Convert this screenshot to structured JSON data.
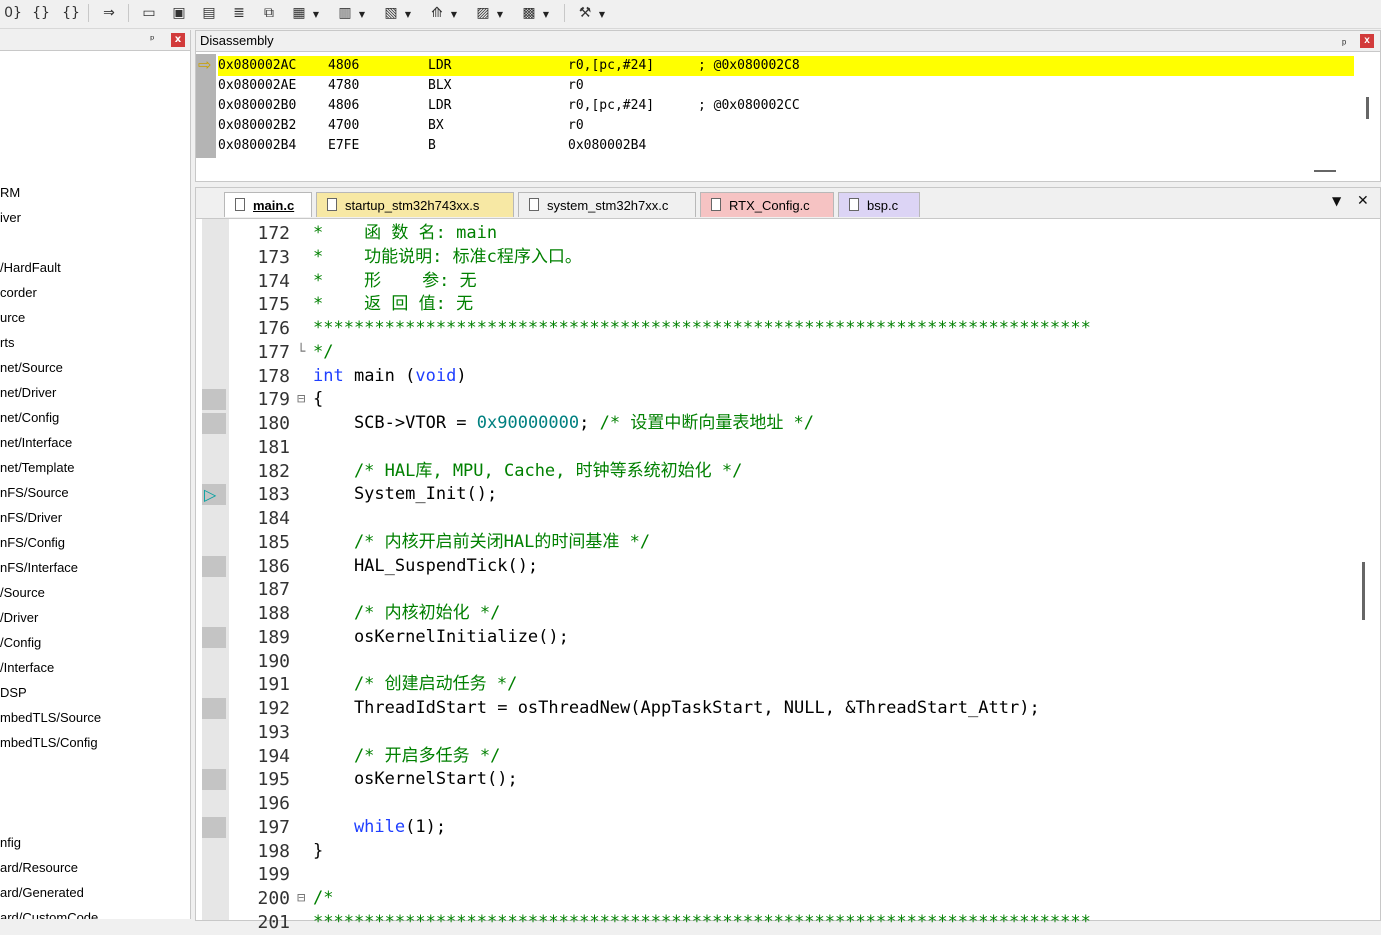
{
  "toolbar": {
    "icons": [
      {
        "name": "indent-brace-icon",
        "glyph": "0}"
      },
      {
        "name": "brace-icon",
        "glyph": "{}"
      },
      {
        "name": "unbrace-icon",
        "glyph": "{}"
      },
      {
        "name": "run-to-icon",
        "glyph": "⇒"
      },
      {
        "name": "command-window-icon",
        "glyph": "▭"
      },
      {
        "name": "disassembly-window-icon",
        "glyph": "▣"
      },
      {
        "name": "symbols-window-icon",
        "glyph": "▤"
      },
      {
        "name": "registers-window-icon",
        "glyph": "≣"
      },
      {
        "name": "call-stack-window-icon",
        "glyph": "⧉"
      },
      {
        "name": "watch-window-icon",
        "glyph": "▦"
      },
      {
        "name": "memory-window-icon",
        "glyph": "▥"
      },
      {
        "name": "serial-window-icon",
        "glyph": "▧"
      },
      {
        "name": "trace-window-icon",
        "glyph": "⟰"
      },
      {
        "name": "system-viewer-icon",
        "glyph": "▨"
      },
      {
        "name": "toolbox-icon",
        "glyph": "▩"
      },
      {
        "name": "settings-tools-icon",
        "glyph": "⚒"
      }
    ]
  },
  "left_panel": {
    "pin": "ᵖ",
    "close": "x",
    "items": [
      "RM",
      "iver",
      "/HardFault",
      "corder",
      "urce",
      "rts",
      "net/Source",
      "net/Driver",
      "net/Config",
      "net/Interface",
      "net/Template",
      "nFS/Source",
      "nFS/Driver",
      "nFS/Config",
      "nFS/Interface",
      "/Source",
      "/Driver",
      "/Config",
      "/Interface",
      "DSP",
      "mbedTLS/Source",
      "mbedTLS/Config",
      "nfig",
      "ard/Resource",
      "ard/Generated",
      "ard/CustomCode"
    ]
  },
  "disassembly": {
    "title": "Disassembly",
    "pin": "ᵖ",
    "close": "x",
    "rows": [
      {
        "addr": "0x080002AC",
        "code": "4806",
        "mnem": "LDR",
        "ops": "r0,[pc,#24]",
        "comment": "; @0x080002C8",
        "current": true
      },
      {
        "addr": "0x080002AE",
        "code": "4780",
        "mnem": "BLX",
        "ops": "r0",
        "comment": "",
        "current": false
      },
      {
        "addr": "0x080002B0",
        "code": "4806",
        "mnem": "LDR",
        "ops": "r0,[pc,#24]",
        "comment": "; @0x080002CC",
        "current": false
      },
      {
        "addr": "0x080002B2",
        "code": "4700",
        "mnem": "BX",
        "ops": "r0",
        "comment": "",
        "current": false
      },
      {
        "addr": "0x080002B4",
        "code": "E7FE",
        "mnem": "B",
        "ops": "0x080002B4",
        "comment": "",
        "current": false
      }
    ],
    "current_arrow": "⇨"
  },
  "editor": {
    "tabs": [
      {
        "label": "main.c",
        "color": "#f0f0f0",
        "active": true
      },
      {
        "label": "startup_stm32h743xx.s",
        "color": "#f7e8a4",
        "active": false
      },
      {
        "label": "system_stm32h7xx.c",
        "color": "#f0f0f0",
        "active": false
      },
      {
        "label": "RTX_Config.c",
        "color": "#f6c3c3",
        "active": false
      },
      {
        "label": "bsp.c",
        "color": "#dcd4f5",
        "active": false
      }
    ],
    "dropdown": "▼",
    "close": "✕",
    "exec_marker": "▷",
    "lines": [
      {
        "n": "172",
        "fold": "",
        "bp": false,
        "t": [
          {
            "c": "cm",
            "s": "*    函 数 名: main"
          }
        ]
      },
      {
        "n": "173",
        "fold": "",
        "bp": false,
        "t": [
          {
            "c": "cm",
            "s": "*    功能说明: 标准c程序入口。"
          }
        ]
      },
      {
        "n": "174",
        "fold": "",
        "bp": false,
        "t": [
          {
            "c": "cm",
            "s": "*    形    参: 无"
          }
        ]
      },
      {
        "n": "175",
        "fold": "",
        "bp": false,
        "t": [
          {
            "c": "cm",
            "s": "*    返 回 值: 无"
          }
        ]
      },
      {
        "n": "176",
        "fold": "",
        "bp": false,
        "t": [
          {
            "c": "cm",
            "s": "****************************************************************************"
          }
        ]
      },
      {
        "n": "177",
        "fold": "└",
        "bp": false,
        "t": [
          {
            "c": "cm",
            "s": "*/"
          }
        ]
      },
      {
        "n": "178",
        "fold": "",
        "bp": false,
        "t": [
          {
            "c": "kw",
            "s": "int"
          },
          {
            "c": "tx",
            "s": " main "
          },
          {
            "c": "tx",
            "s": "("
          },
          {
            "c": "kw",
            "s": "void"
          },
          {
            "c": "tx",
            "s": ")"
          }
        ]
      },
      {
        "n": "179",
        "fold": "⊟",
        "bp": true,
        "t": [
          {
            "c": "tx",
            "s": "{"
          }
        ]
      },
      {
        "n": "180",
        "fold": "",
        "bp": true,
        "t": [
          {
            "c": "tx",
            "s": "    SCB->VTOR = "
          },
          {
            "c": "nm",
            "s": "0x90000000"
          },
          {
            "c": "tx",
            "s": "; "
          },
          {
            "c": "cm",
            "s": "/* 设置中断向量表地址 */"
          }
        ]
      },
      {
        "n": "181",
        "fold": "",
        "bp": false,
        "t": []
      },
      {
        "n": "182",
        "fold": "",
        "bp": false,
        "t": [
          {
            "c": "cm",
            "s": "    /* HAL库, MPU, Cache, 时钟等系统初始化 */"
          }
        ]
      },
      {
        "n": "183",
        "fold": "",
        "bp": true,
        "exec": true,
        "t": [
          {
            "c": "tx",
            "s": "    System_Init();"
          }
        ]
      },
      {
        "n": "184",
        "fold": "",
        "bp": false,
        "t": []
      },
      {
        "n": "185",
        "fold": "",
        "bp": false,
        "t": [
          {
            "c": "cm",
            "s": "    /* 内核开启前关闭HAL的时间基准 */"
          }
        ]
      },
      {
        "n": "186",
        "fold": "",
        "bp": true,
        "t": [
          {
            "c": "tx",
            "s": "    HAL_SuspendTick();"
          }
        ]
      },
      {
        "n": "187",
        "fold": "",
        "bp": false,
        "t": []
      },
      {
        "n": "188",
        "fold": "",
        "bp": false,
        "t": [
          {
            "c": "cm",
            "s": "    /* 内核初始化 */"
          }
        ]
      },
      {
        "n": "189",
        "fold": "",
        "bp": true,
        "t": [
          {
            "c": "tx",
            "s": "    osKernelInitialize();"
          }
        ]
      },
      {
        "n": "190",
        "fold": "",
        "bp": false,
        "t": []
      },
      {
        "n": "191",
        "fold": "",
        "bp": false,
        "t": [
          {
            "c": "cm",
            "s": "    /* 创建启动任务 */"
          }
        ]
      },
      {
        "n": "192",
        "fold": "",
        "bp": true,
        "t": [
          {
            "c": "tx",
            "s": "    ThreadIdStart = osThreadNew(AppTaskStart, NULL, &ThreadStart_Attr);"
          }
        ]
      },
      {
        "n": "193",
        "fold": "",
        "bp": false,
        "t": []
      },
      {
        "n": "194",
        "fold": "",
        "bp": false,
        "t": [
          {
            "c": "cm",
            "s": "    /* 开启多任务 */"
          }
        ]
      },
      {
        "n": "195",
        "fold": "",
        "bp": true,
        "t": [
          {
            "c": "tx",
            "s": "    osKernelStart();"
          }
        ]
      },
      {
        "n": "196",
        "fold": "",
        "bp": false,
        "t": []
      },
      {
        "n": "197",
        "fold": "",
        "bp": true,
        "t": [
          {
            "c": "kw",
            "s": "    while"
          },
          {
            "c": "tx",
            "s": "(1);"
          }
        ]
      },
      {
        "n": "198",
        "fold": "",
        "bp": false,
        "t": [
          {
            "c": "tx",
            "s": "}"
          }
        ]
      },
      {
        "n": "199",
        "fold": "",
        "bp": false,
        "t": []
      },
      {
        "n": "200",
        "fold": "⊟",
        "bp": false,
        "t": [
          {
            "c": "cm",
            "s": "/*"
          }
        ]
      },
      {
        "n": "201",
        "fold": "",
        "bp": false,
        "t": [
          {
            "c": "cm",
            "s": "****************************************************************************"
          }
        ]
      }
    ]
  }
}
